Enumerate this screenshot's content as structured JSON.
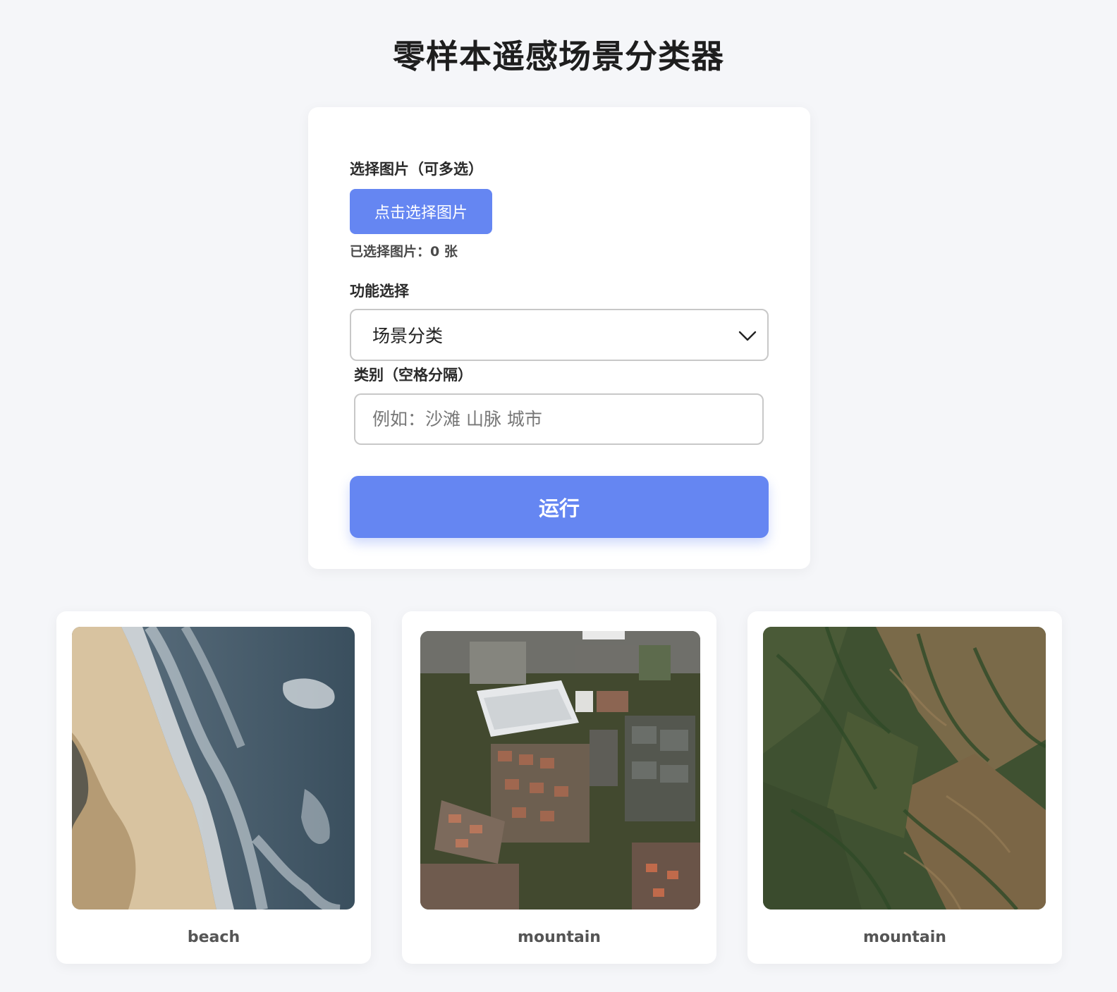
{
  "title": "零样本遥感场景分类器",
  "form": {
    "image_label": "选择图片（可多选）",
    "upload_button": "点击选择图片",
    "selected_count": "已选择图片：0 张",
    "function_label": "功能选择",
    "function_value": "场景分类",
    "category_label": "类别（空格分隔）",
    "category_placeholder": "例如：沙滩 山脉 城市",
    "run_button": "运行"
  },
  "results": [
    {
      "label": "beach",
      "image": "beach-aerial-image"
    },
    {
      "label": "mountain",
      "image": "urban-aerial-image"
    },
    {
      "label": "mountain",
      "image": "mountain-aerial-image"
    }
  ],
  "colors": {
    "accent": "#6586f2",
    "background": "#f5f6f9",
    "card": "#ffffff"
  }
}
